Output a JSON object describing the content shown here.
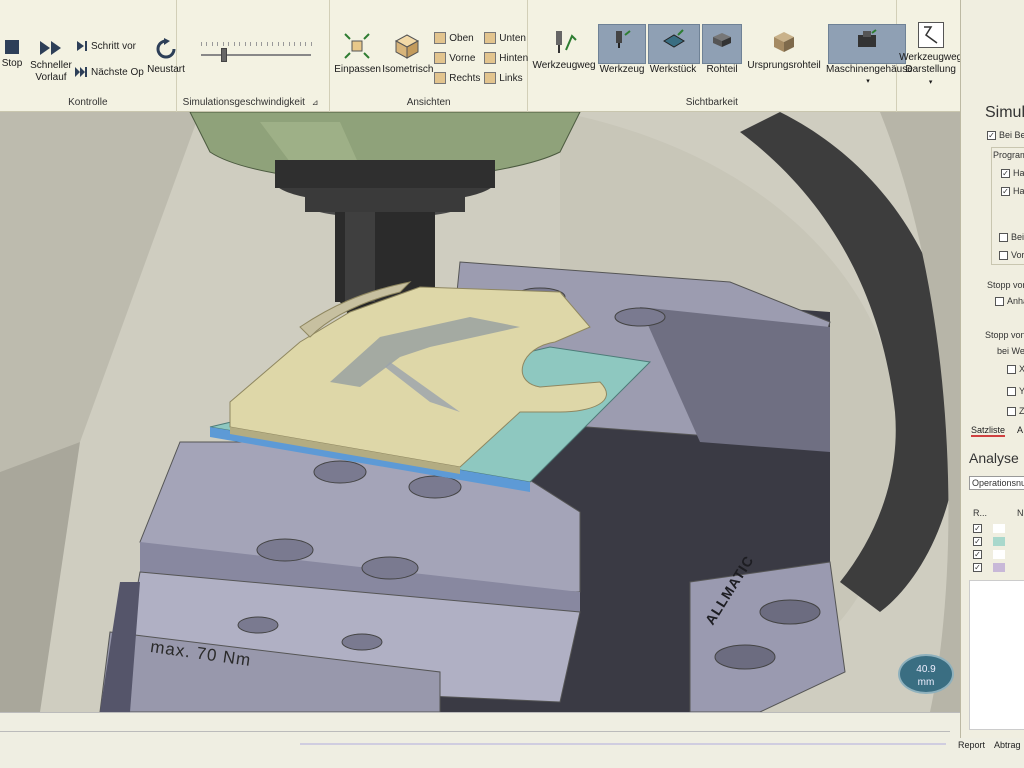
{
  "ribbon": {
    "kontrolle": {
      "label": "Kontrolle",
      "stop": "Stop",
      "schneller": "Schneller Vorlauf",
      "schritt_vor": "Schritt vor",
      "naechste_op": "Nächste Op",
      "neustart": "Neustart"
    },
    "speed": {
      "label": "Simulationsgeschwindigkeit",
      "value_fraction": 0.2
    },
    "ansichten": {
      "label": "Ansichten",
      "einpassen": "Einpassen",
      "isometrisch": "Isometrisch",
      "oben": "Oben",
      "unten": "Unten",
      "vorne": "Vorne",
      "hinten": "Hinten",
      "rechts": "Rechts",
      "links": "Links"
    },
    "sichtbarkeit": {
      "label": "Sichtbarkeit",
      "werkzeugweg": "Werkzeugweg",
      "werkzeug": "Werkzeug",
      "werkstueck": "Werkstück",
      "rohteil": "Rohteil",
      "ursprungsrohteil": "Ursprungsrohteil",
      "maschinengehaeuse": "Maschinengehäuse"
    },
    "werkzeugweg_darstellung": "Werkzeugweg Darstellung"
  },
  "viewport": {
    "vise_label": "max. 70 Nm",
    "brand": "ALLMATIC",
    "measure_value": "40.9",
    "measure_unit": "mm"
  },
  "right_panel": {
    "title": "Simula",
    "bei_be": "Bei Be",
    "program": "Program",
    "ha1": "Ha",
    "ha2": "Ha",
    "bei": "Bei",
    "vor": "Vor",
    "stopp_vor": "Stopp vor",
    "anha": "Anha",
    "stopp_von": "Stopp von",
    "bei_we": "bei We",
    "x": "X",
    "y": "Y",
    "z": "Z",
    "tab_satzliste": "Satzliste",
    "tab_a": "A",
    "analyse_title": "Analyse",
    "operations": "Operationsnu",
    "col_r": "R...",
    "col_n": "N",
    "tab_report": "Report",
    "tab_abtrag": "Abtrag",
    "colors": [
      "#ffffff",
      "#a9d8cc",
      "#ffffff",
      "#c8b8d8"
    ]
  },
  "panel_controls": "▾ ⊓ ✕"
}
